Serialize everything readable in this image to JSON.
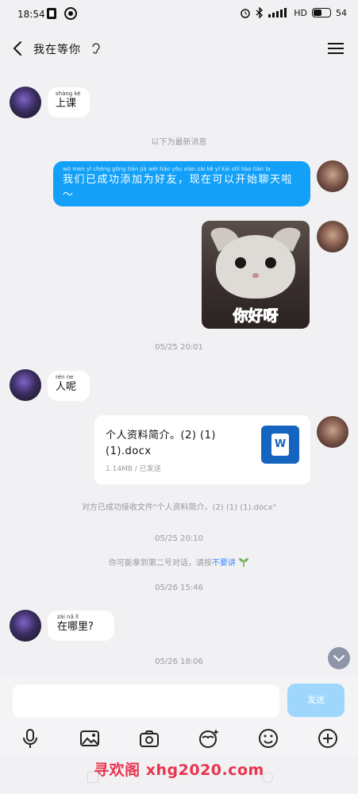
{
  "status_bar": {
    "time": "18:54",
    "network": "HD",
    "battery": "54",
    "battery_level": 0.54
  },
  "header": {
    "title": "我在等你"
  },
  "messages": {
    "m1": {
      "pinyin": "shàng kè",
      "text": "上课"
    },
    "sys1": "以下为最新消息",
    "m2": {
      "pinyin": "wǒ men yǐ chéng gōng tiān jiā wéi hǎo yǒu xiàn zài kě yǐ kāi shǐ liáo tiān la",
      "text": "我们已成功添加为好友，现在可以开始聊天啦～"
    },
    "sticker_text": "你好呀",
    "time1": "05/25 20:01",
    "m3": {
      "pinyin": "rén ne",
      "text": "人呢"
    },
    "file": {
      "name": "个人资料简介。(2) (1) (1).docx",
      "meta": "1.14MB / 已发送",
      "icon_letter": "W"
    },
    "sys2": "对方已成功接收文件\"个人资料简介。(2) (1) (1).docx\"",
    "time2": "05/25 20:10",
    "sys3_prefix": "你可能拿到第二号对话，请按",
    "sys3_link": "不要讲",
    "time3": "05/26 15:46",
    "m4": {
      "pinyin": "zài nǎ lǐ",
      "text": "在哪里?"
    },
    "time4": "05/26 18:06"
  },
  "input": {
    "placeholder": "",
    "send_label": "发送"
  },
  "watermark": "寻欢阁 xhg2020.com"
}
